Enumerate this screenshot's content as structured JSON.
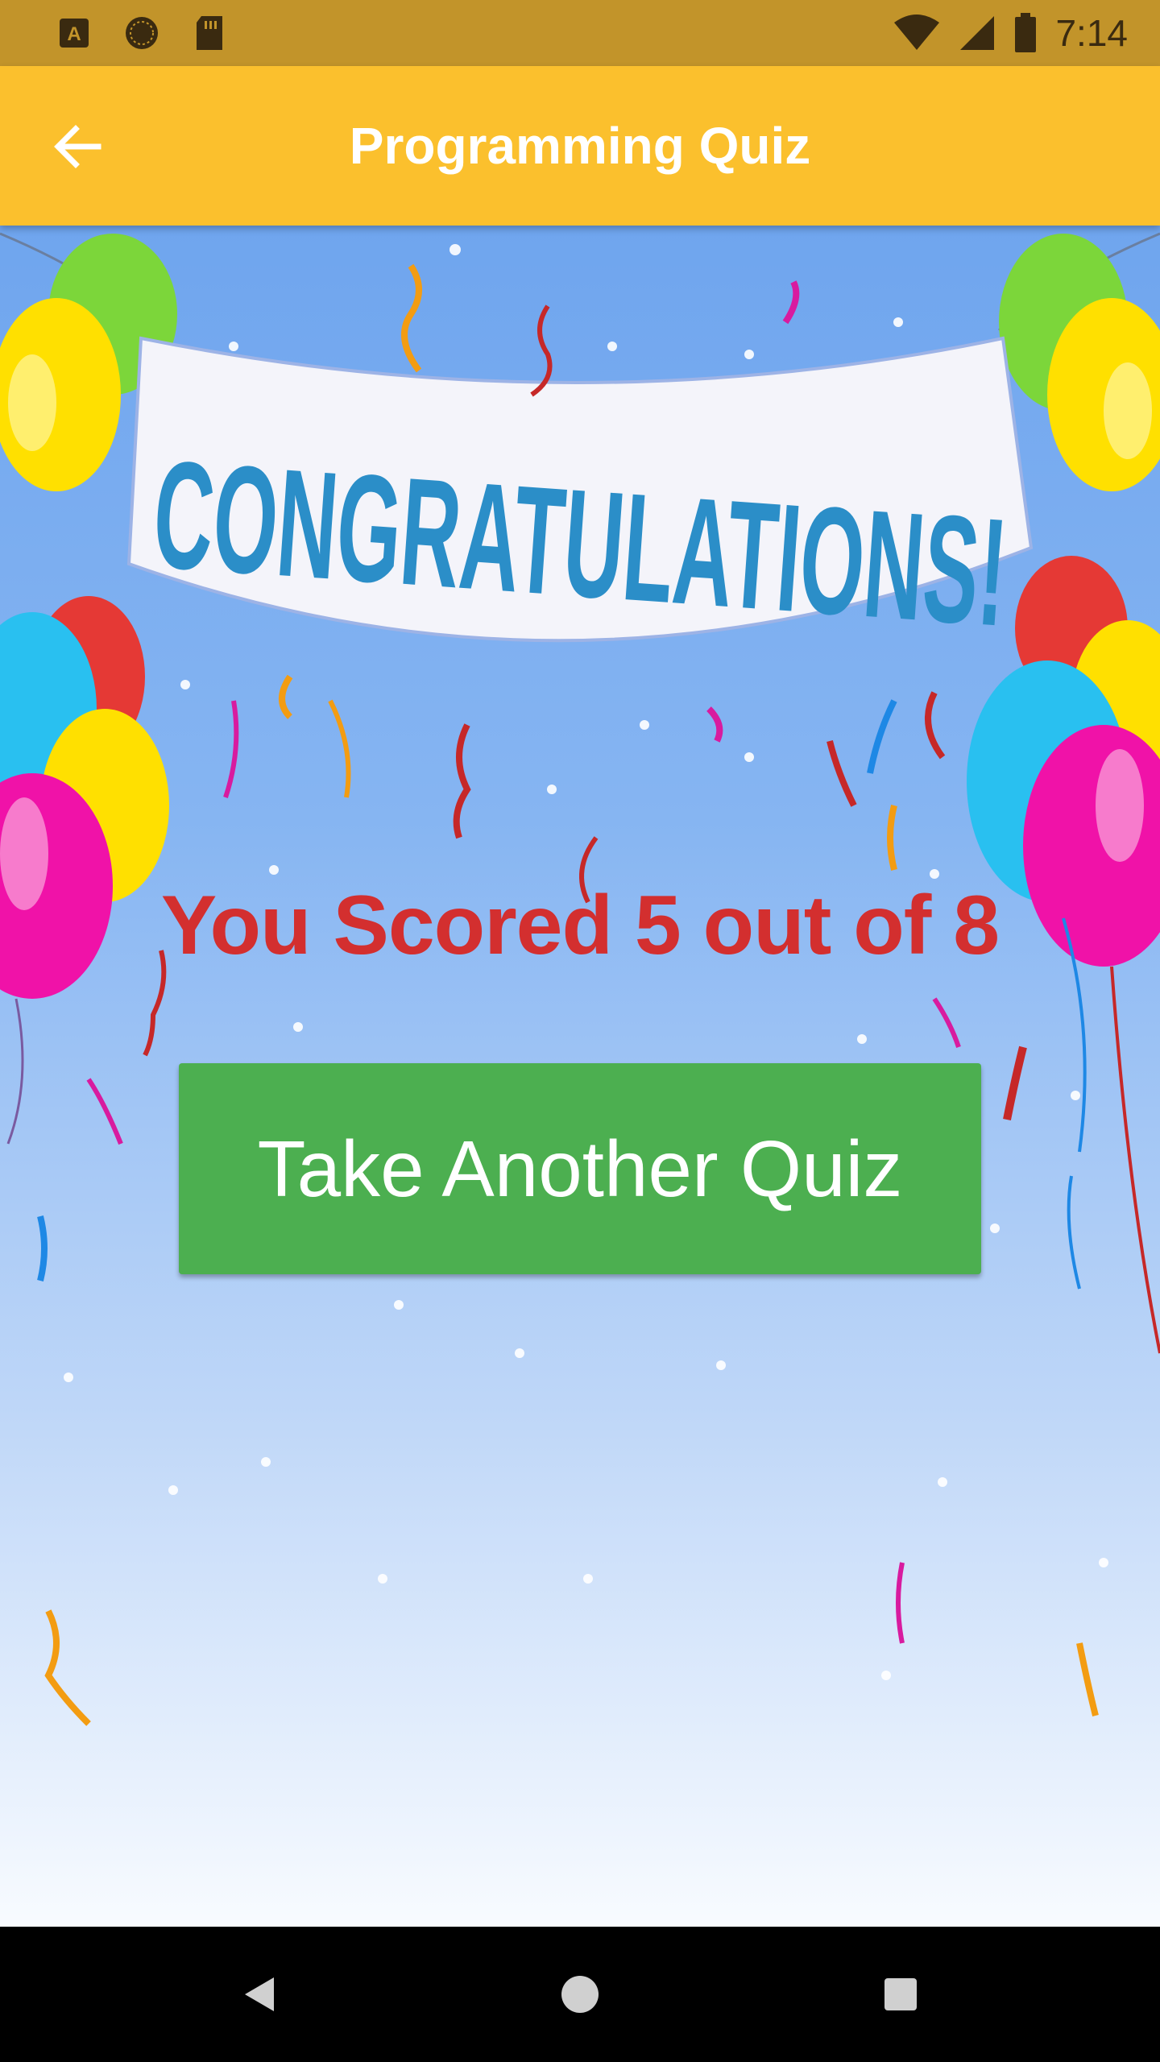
{
  "status_bar": {
    "time": "7:14",
    "icons_left": [
      "a-notification-icon",
      "sync-icon",
      "sd-card-icon"
    ],
    "icons_right": [
      "wifi-icon",
      "signal-icon",
      "battery-icon"
    ]
  },
  "app_bar": {
    "title": "Programming Quiz",
    "back_icon": "arrow-back-icon"
  },
  "main": {
    "banner_text": "CONGRATULATIONS!",
    "score_text": "You Scored 5 out of 8",
    "button_label": "Take Another Quiz"
  },
  "nav_bar": {
    "icons": [
      "back-triangle-icon",
      "home-circle-icon",
      "recents-square-icon"
    ]
  },
  "colors": {
    "status_bar": "#C2942A",
    "app_bar": "#FBC02D",
    "score_text": "#D32F2F",
    "button": "#4CAF50"
  }
}
